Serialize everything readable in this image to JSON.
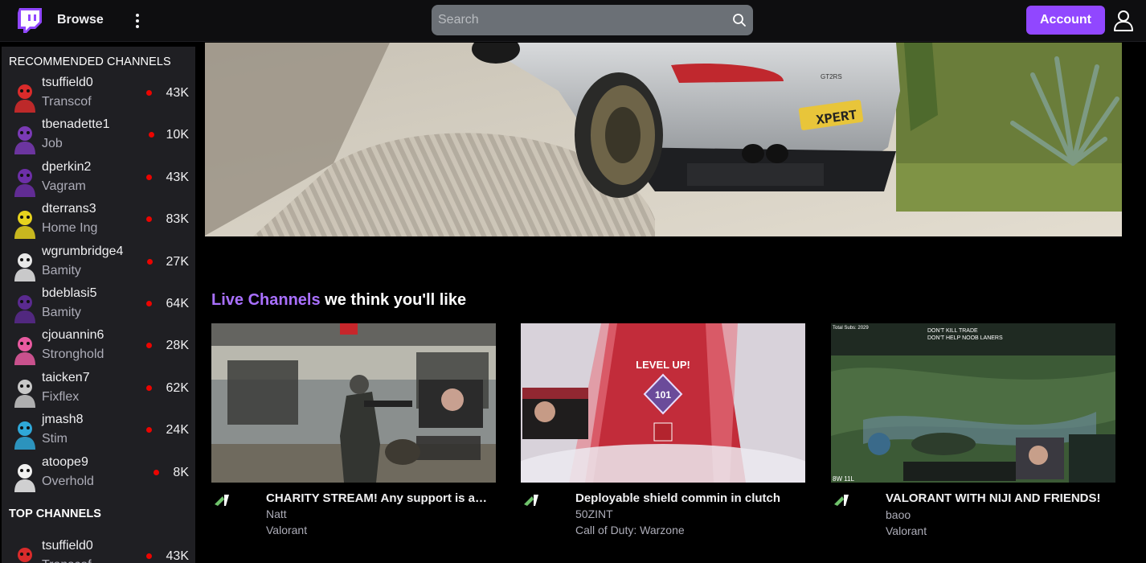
{
  "topbar": {
    "browse_label": "Browse",
    "search_placeholder": "Search",
    "account_label": "Account"
  },
  "sidebar": {
    "recommended_heading": "RECOMMENDED CHANNELS",
    "top_heading": "TOP CHANNELS",
    "recommended": [
      {
        "name": "tsuffield0",
        "game": "Transcof",
        "viewers": "43K",
        "color": "#d92b2b"
      },
      {
        "name": "tbenadette1",
        "game": "Job",
        "viewers": "10K",
        "color": "#7a3ab5"
      },
      {
        "name": "dperkin2",
        "game": "Vagram",
        "viewers": "43K",
        "color": "#6d2fa8"
      },
      {
        "name": "dterrans3",
        "game": "Home Ing",
        "viewers": "83K",
        "color": "#e6d21e"
      },
      {
        "name": "wgrumbridge4",
        "game": "Bamity",
        "viewers": "27K",
        "color": "#e8e8e8"
      },
      {
        "name": "bdeblasi5",
        "game": "Bamity",
        "viewers": "64K",
        "color": "#5a2a8f"
      },
      {
        "name": "cjouannin6",
        "game": "Stronghold",
        "viewers": "28K",
        "color": "#e85aa0"
      },
      {
        "name": "taicken7",
        "game": "Fixflex",
        "viewers": "62K",
        "color": "#c8c8c8"
      },
      {
        "name": "jmash8",
        "game": "Stim",
        "viewers": "24K",
        "color": "#2fa8d8"
      },
      {
        "name": "atoope9",
        "game": "Overhold",
        "viewers": "8K",
        "color": "#f0f0f0"
      }
    ],
    "top": [
      {
        "name": "tsuffield0",
        "game": "Transcof",
        "viewers": "43K",
        "color": "#d92b2b"
      }
    ]
  },
  "live": {
    "heading_accent": "Live Channels",
    "heading_rest": " we think you'll like",
    "cards": [
      {
        "title": "CHARITY STREAM! Any support is appreciated",
        "streamer": "Natt",
        "category": "Valorant",
        "thumb": "warzone-gameplay"
      },
      {
        "title": "Deployable shield commin in clutch",
        "streamer": "50ZINT",
        "category": "Call of Duty: Warzone",
        "thumb": "apex-level-up",
        "overlay_text": "LEVEL UP!",
        "level": "101"
      },
      {
        "title": "VALORANT WITH NIJI AND FRIENDS!",
        "streamer": "baoo",
        "category": "Valorant",
        "thumb": "lol-gameplay",
        "overlay_line1": "DON'T KILL TRADE",
        "overlay_line2": "DON'T HELP NOOB LANERS",
        "overlay_subs": "Total Subs: 2029",
        "overlay_score": "8W 11L"
      }
    ]
  },
  "hero": {
    "plate_text": "XPERT",
    "badge_text": "GT2RS"
  },
  "colors": {
    "brand": "#9147ff",
    "accent": "#a970ff",
    "live_dot": "#eb0400"
  }
}
